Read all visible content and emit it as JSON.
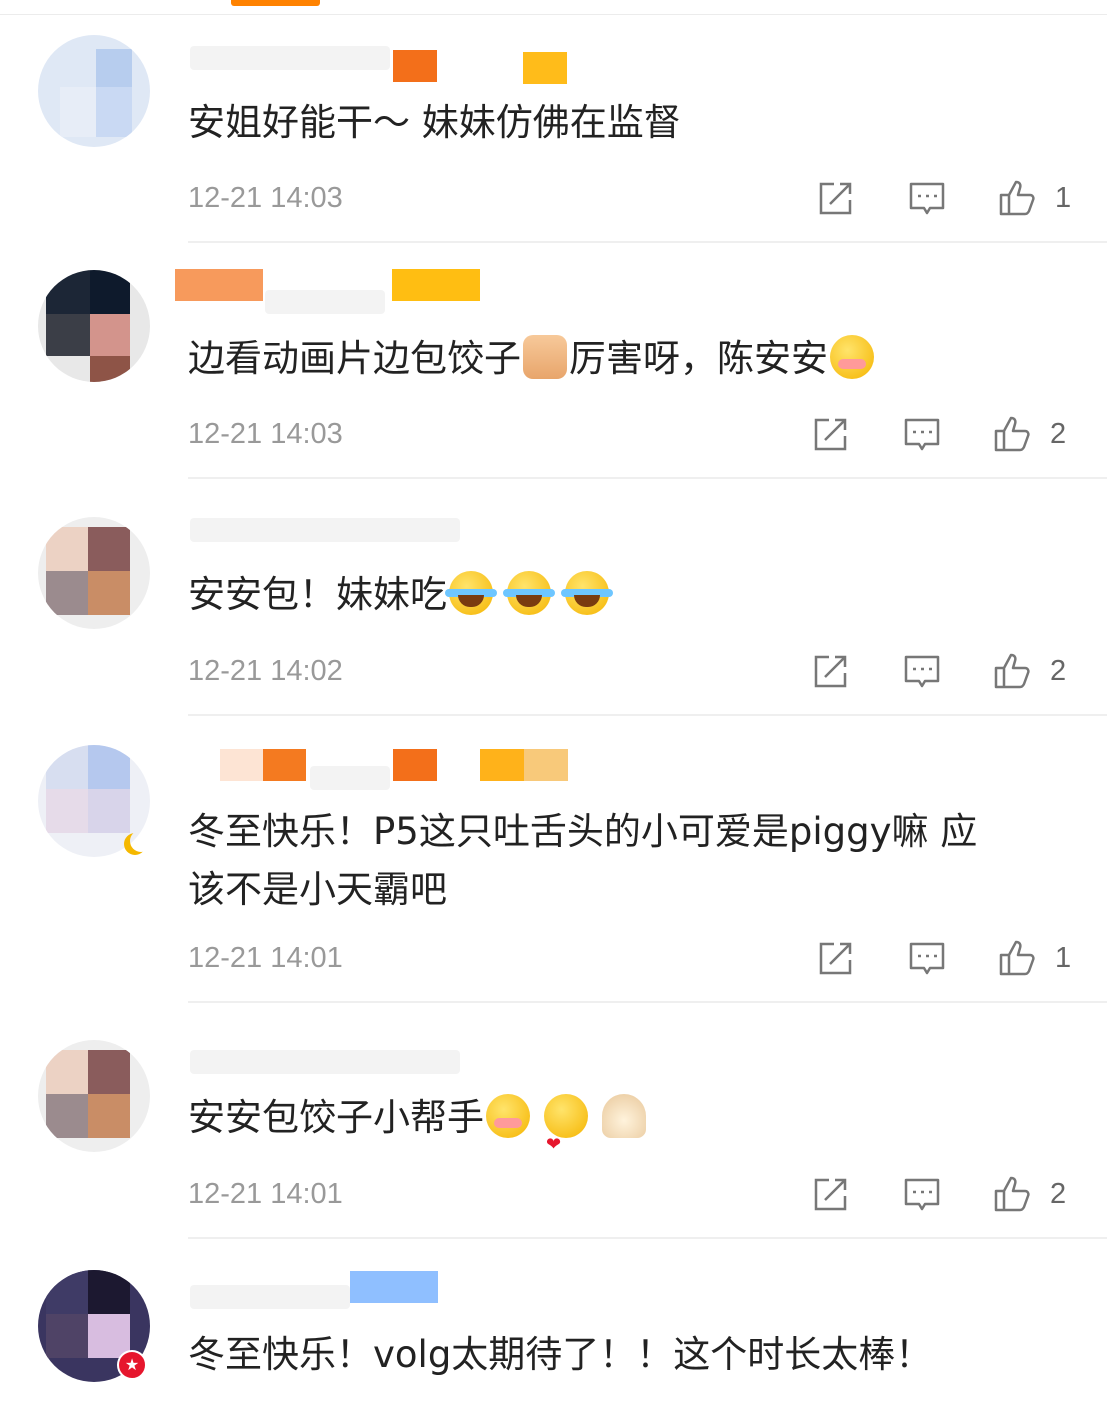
{
  "comments": [
    {
      "content": "安姐好能干～ 妹妹仿佛在监督",
      "time": "12-21 14:03",
      "likes": "1"
    },
    {
      "content_before": "边看动画片边包饺子",
      "content_mid": "厉害呀，陈安安",
      "time": "12-21 14:03",
      "likes": "2"
    },
    {
      "content": "安安包！妹妹吃",
      "time": "12-21 14:02",
      "likes": "2"
    },
    {
      "content_line1": "冬至快乐！P5这只吐舌头的小可爱是piggy嘛 应",
      "content_line2": "该不是小天霸吧",
      "time": "12-21 14:01",
      "likes": "1"
    },
    {
      "content": "安安包饺子小帮手",
      "time": "12-21 14:01",
      "likes": "2"
    },
    {
      "content": "冬至快乐！volg太期待了！！这个时长太棒！"
    }
  ],
  "icons": {
    "share": "share-icon",
    "reply": "comment-icon",
    "like": "thumbs-up-icon"
  },
  "colors": {
    "accent": "#ff8200",
    "time": "#999999",
    "verified": "#e6162d"
  }
}
